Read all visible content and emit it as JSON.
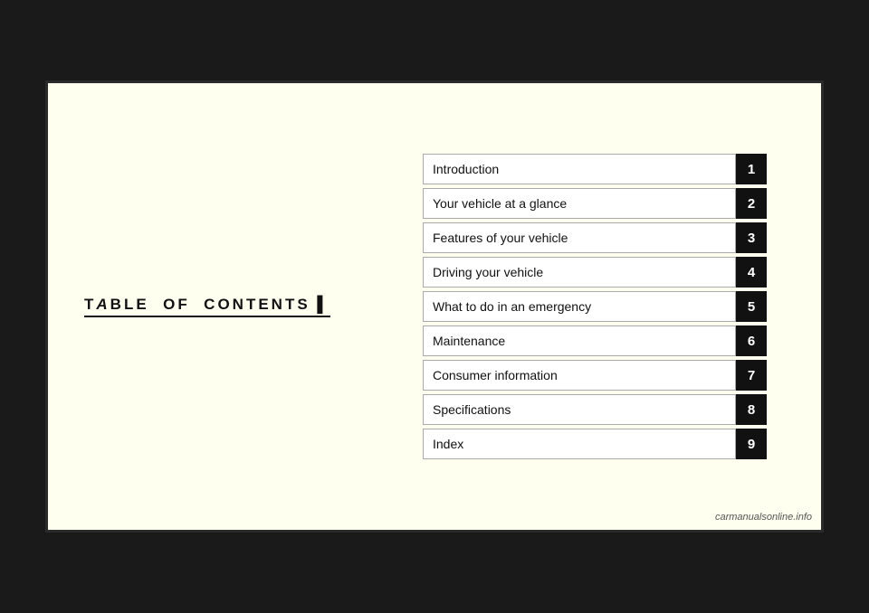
{
  "page": {
    "title": "TABLE OF CONTENTS",
    "background_color": "#fffff0",
    "border_color": "#2a2a2a"
  },
  "toc": {
    "items": [
      {
        "label": "Introduction",
        "number": "1"
      },
      {
        "label": "Your vehicle at a glance",
        "number": "2"
      },
      {
        "label": "Features of your vehicle",
        "number": "3"
      },
      {
        "label": "Driving your vehicle",
        "number": "4"
      },
      {
        "label": "What to do in an emergency",
        "number": "5"
      },
      {
        "label": "Maintenance",
        "number": "6"
      },
      {
        "label": "Consumer information",
        "number": "7"
      },
      {
        "label": "Specifications",
        "number": "8"
      },
      {
        "label": "Index",
        "number": "9"
      }
    ]
  },
  "watermark": {
    "text": "carmanualsonline.info"
  }
}
